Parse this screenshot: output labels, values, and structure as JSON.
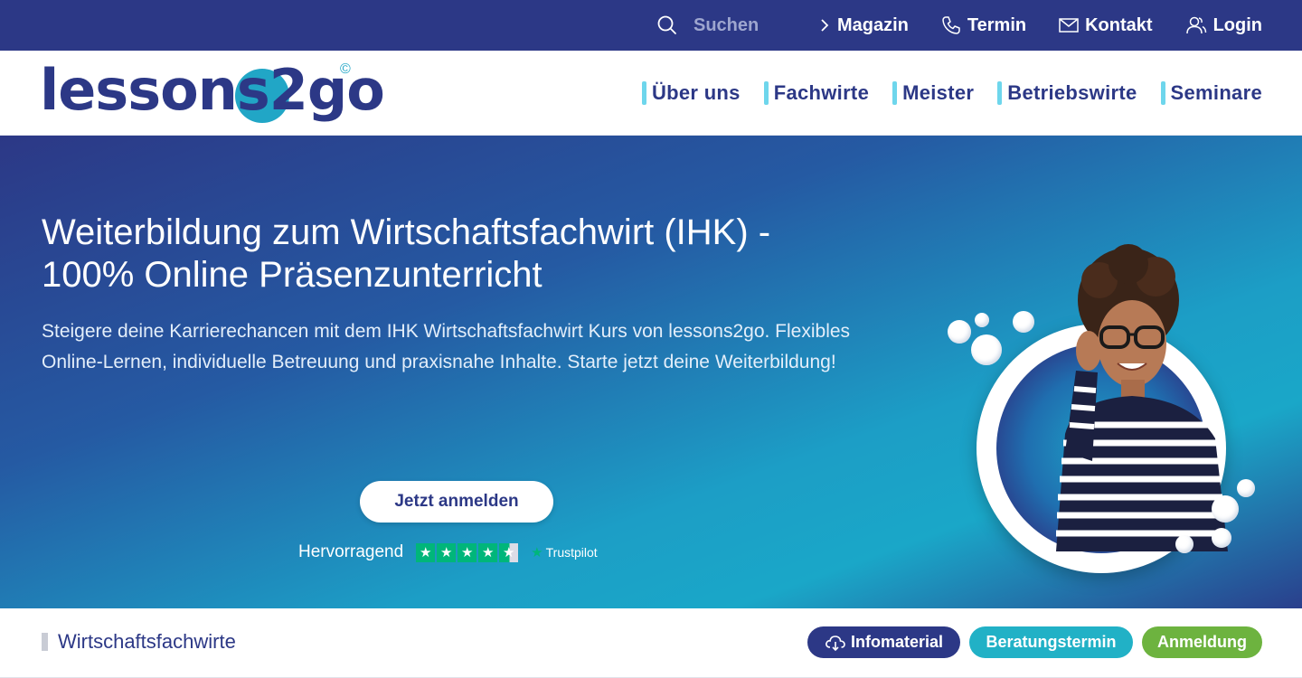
{
  "topbar": {
    "search_placeholder": "Suchen",
    "links": [
      {
        "label": "Magazin",
        "icon": "chevron-right-icon"
      },
      {
        "label": "Termin",
        "icon": "phone-icon"
      },
      {
        "label": "Kontakt",
        "icon": "mail-icon"
      },
      {
        "label": "Login",
        "icon": "users-icon"
      }
    ]
  },
  "header": {
    "logo_text": "lessons2go",
    "logo_symbol": "©",
    "nav": [
      {
        "label": "Über uns"
      },
      {
        "label": "Fachwirte"
      },
      {
        "label": "Meister"
      },
      {
        "label": "Betriebswirte"
      },
      {
        "label": "Seminare"
      }
    ]
  },
  "hero": {
    "title_line1": "Weiterbildung zum Wirtschaftsfachwirt (IHK) -",
    "title_line2": "100% Online Präsenzunterricht",
    "subtitle": "Steigere deine Karrierechancen mit dem IHK Wirtschaftsfachwirt Kurs von lessons2go. Flexibles Online-Lernen, individuelle Betreuung und praxisnahe Inhalte. Starte jetzt deine Weiterbildung!",
    "cta_label": "Jetzt anmelden",
    "trustpilot": {
      "rating_text": "Hervorragend",
      "stars": 4.5,
      "brand": "Trustpilot"
    }
  },
  "subbar": {
    "crumb": "Wirtschaftsfachwirte",
    "buttons": {
      "info": "Infomaterial",
      "termin": "Beratungstermin",
      "anmeldung": "Anmeldung"
    }
  },
  "colors": {
    "primary": "#2c3886",
    "accent": "#21b1c6",
    "green": "#6db33f",
    "trustpilot": "#00b67a"
  }
}
